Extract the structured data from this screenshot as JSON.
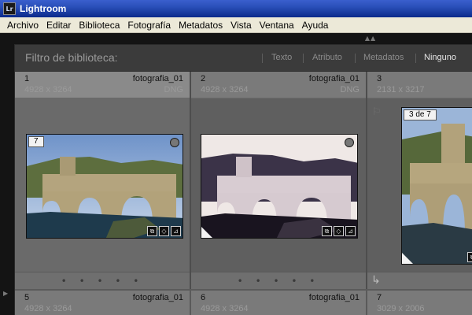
{
  "window": {
    "title": "Lightroom",
    "icon_label": "Lr"
  },
  "menu": [
    "Archivo",
    "Editar",
    "Biblioteca",
    "Fotografía",
    "Metadatos",
    "Vista",
    "Ventana",
    "Ayuda"
  ],
  "filter": {
    "title": "Filtro de biblioteca:",
    "options": [
      "Texto",
      "Atributo",
      "Metadatos",
      "Ninguno"
    ],
    "active": "Ninguno"
  },
  "grid": {
    "cells": [
      {
        "num": "1",
        "file": "fotografia_01",
        "dims": "4928 x 3264",
        "format": "DNG",
        "badge": "7"
      },
      {
        "num": "2",
        "file": "fotografia_01",
        "dims": "4928 x 3264",
        "format": "DNG"
      },
      {
        "num": "3",
        "dims": "2131 x 3217",
        "badge": "3 de 7"
      },
      {
        "num": "5",
        "file": "fotografia_01",
        "dims": "4928 x 3264"
      },
      {
        "num": "6",
        "file": "fotografia_01",
        "dims": "4928 x 3264"
      },
      {
        "num": "7",
        "dims": "3029 x 2006"
      }
    ],
    "footer_dots": "• • • • •"
  },
  "icons": {
    "collapse": "collapse-up-icon",
    "rating": "circle-select-icon",
    "flag": "flag-icon",
    "rotate": "rotate-left-icon",
    "stack": "stack-icon",
    "keyword": "keyword-tag-icon",
    "crop": "crop-icon"
  },
  "colors": {
    "titlebar": "#0a2a8c",
    "panel": "#5a5a5a",
    "header": "#7a7a7a",
    "menubar": "#ece9d8"
  }
}
